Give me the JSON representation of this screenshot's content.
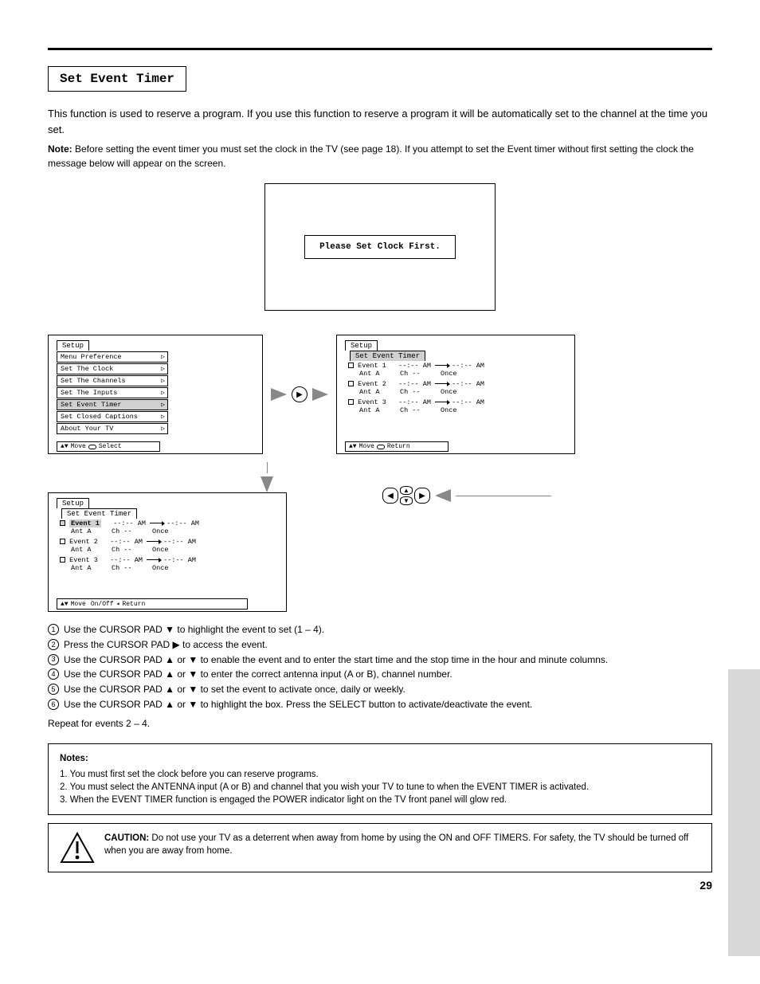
{
  "title": "Set Event Timer",
  "intro": "This function is used to reserve a program. If you use this function to reserve a program it will be automatically set to the channel at the time you set.",
  "clock_note_prefix": "Note:",
  "clock_note": " Before setting the event timer you must set the clock in the TV (see page 18). If you attempt to set the Event timer without first setting the clock the message below will appear on the screen.",
  "clock_msg": "Please Set Clock First.",
  "screenA": {
    "tab": "Setup",
    "items": [
      "Menu Preference",
      "Set The Clock",
      "Set The Channels",
      "Set The Inputs",
      "Set Event Timer",
      "Set Closed Captions",
      "About Your TV"
    ],
    "highlighted": "Set Event Timer",
    "foot_move": "Move",
    "foot_sel": "Select"
  },
  "screenB": {
    "tab1": "Setup",
    "tab2": "Set Event Timer",
    "events": [
      {
        "label": "Event 1",
        "t1": "--:-- AM",
        "t2": "--:-- AM",
        "ant": "Ant A",
        "ch": "Ch --",
        "freq": "Once"
      },
      {
        "label": "Event 2",
        "t1": "--:-- AM",
        "t2": "--:-- AM",
        "ant": "Ant A",
        "ch": "Ch --",
        "freq": "Once"
      },
      {
        "label": "Event 3",
        "t1": "--:-- AM",
        "t2": "--:-- AM",
        "ant": "Ant A",
        "ch": "Ch --",
        "freq": "Once"
      }
    ],
    "foot_move": "Move",
    "foot_ret": "Return"
  },
  "screenC": {
    "tab1": "Setup",
    "tab2": "Set Event Timer",
    "highlighted_event": "Event 1",
    "events": [
      {
        "label": "Event 1",
        "t1": "--:-- AM",
        "t2": "--:-- AM",
        "ant": "Ant A",
        "ch": "Ch --",
        "freq": "Once"
      },
      {
        "label": "Event 2",
        "t1": "--:-- AM",
        "t2": "--:-- AM",
        "ant": "Ant A",
        "ch": "Ch --",
        "freq": "Once"
      },
      {
        "label": "Event 3",
        "t1": "--:-- AM",
        "t2": "--:-- AM",
        "ant": "Ant A",
        "ch": "Ch --",
        "freq": "Once"
      }
    ],
    "foot_move": "Move",
    "foot_on": "On/Off",
    "foot_ret": "Return"
  },
  "steps": [
    "Use the CURSOR PAD ▼ to highlight the event to set (1 – 4).",
    "Press the CURSOR PAD ▶ to access the event.",
    "Use the CURSOR PAD ▲ or ▼ to enable the event and to enter the start time and the stop time in the hour and minute columns.",
    "Use the CURSOR PAD ▲ or ▼ to enter the correct antenna input (A or B), channel number.",
    "Use the CURSOR PAD ▲ or ▼ to set the event to activate once, daily or weekly.",
    "Use the CURSOR PAD ▲ or ▼ to highlight the box. Press the SELECT button to activate/deactivate the event."
  ],
  "notes": {
    "title": "Notes:",
    "items": [
      "1. You must first set the clock before you can reserve programs.",
      "2. You must select the ANTENNA input (A or B) and channel that you wish your TV to tune to when the EVENT TIMER is activated.",
      "3. When the EVENT TIMER function is engaged the POWER indicator light on the TV front panel will glow red."
    ]
  },
  "caution": {
    "title": "CAUTION:",
    "text": "Do not use your TV as a deterrent when away from home by using the ON and OFF TIMERS. For safety, the TV should be turned off when you are away from home."
  },
  "page_number": "29"
}
